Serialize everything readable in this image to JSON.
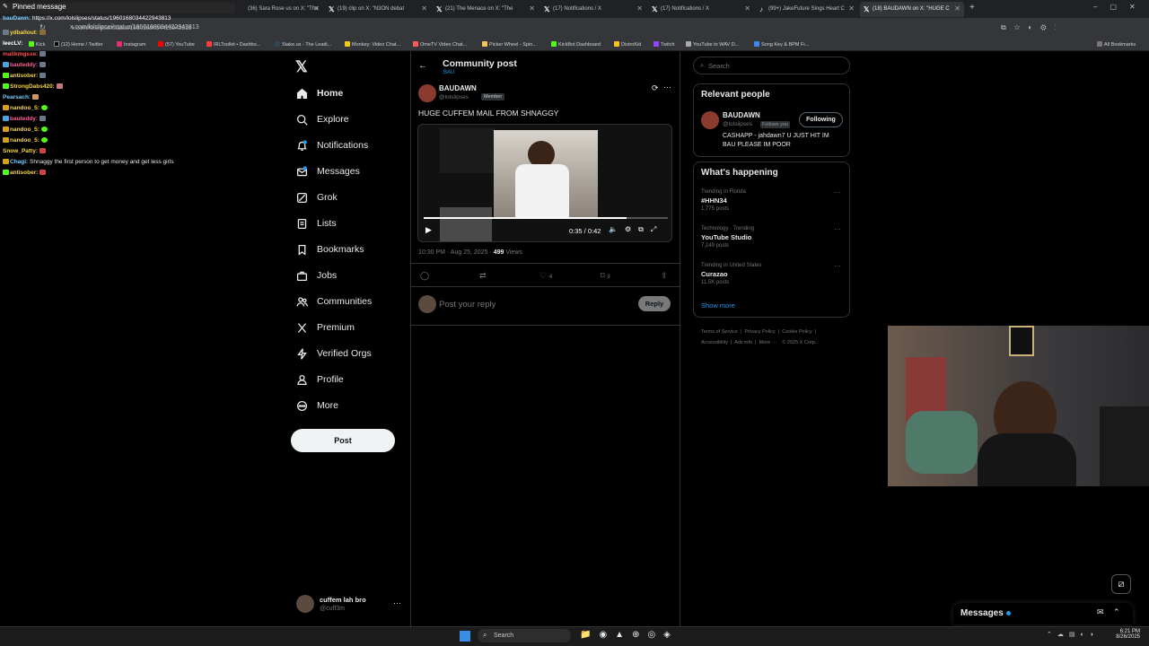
{
  "browser": {
    "tabs": [
      {
        "label": "(36) Sara Rose us",
        "suffix": "on X: \"The"
      },
      {
        "label": "(19) clip",
        "suffix": "on X: \"N3ON debat"
      },
      {
        "label": "(21) The Menace",
        "suffix": "on X: \"The"
      },
      {
        "label": "(17) Notifications / X",
        "suffix": ""
      },
      {
        "label": "(17) Notifications / X",
        "suffix": ""
      },
      {
        "label": "(99+) JakeFuture Sings Heart C",
        "suffix": ""
      },
      {
        "label": "(18) BAUDAWN on X: \"HUGE C",
        "suffix": ""
      }
    ],
    "url": "x.com/lolslipsei/status/1960168034422943813",
    "bookmarks": [
      "Kick",
      "(12) Home / Twitter",
      "Instagram",
      "(57) YouTube",
      "IRLToolkit • Dashbo...",
      "Stake.us - The Leadi...",
      "Monkey: Video Chat...",
      "OmeTV Video Chat...",
      "Picker Wheel - Spin...",
      "KickBot Dashboard",
      "DistroKid",
      "Twitch",
      "YouTube to WAV D...",
      "Song Key & BPM Fi..."
    ],
    "all_bookmarks": "All Bookmarks"
  },
  "chat": {
    "pinned_title": "Pinned message",
    "pinned_user": "bauDawn:",
    "pinned_url": "https://x.com/lolslipses/status/1960168034422943813",
    "pinned_url2": "x.com/lolslipsei/status/1960168034422943813",
    "lines": [
      {
        "user": "ydballout:",
        "msg": "",
        "color": "#f5d547"
      },
      {
        "user": "leecLV:",
        "msg": "",
        "color": "#ffffff"
      },
      {
        "user": "malikmgsse:",
        "msg": "",
        "color": "#ff4f4f"
      },
      {
        "user": "bauteddy:",
        "msg": "",
        "color": "#ff5f9e"
      },
      {
        "user": "antisober:",
        "msg": "",
        "color": "#f5d547"
      },
      {
        "user": "StrongDabs420:",
        "msg": "",
        "color": "#f5d547"
      },
      {
        "user": "Pearsach:",
        "msg": "",
        "color": "#7ad0ff"
      },
      {
        "user": "nandoo_5:",
        "msg": "",
        "color": "#f5d547"
      },
      {
        "user": "bauteddy:",
        "msg": "",
        "color": "#ff5f9e"
      },
      {
        "user": "nandoo_5:",
        "msg": "",
        "color": "#f5d547"
      },
      {
        "user": "nandoo_5:",
        "msg": "",
        "color": "#f5d547"
      },
      {
        "user": "Snow_Patty:",
        "msg": "",
        "color": "#f5d547"
      },
      {
        "user": "Chagi:",
        "msg": "Shnaggy the first person to get money and get less girls",
        "color": "#7ad0ff"
      },
      {
        "user": "antisober:",
        "msg": "",
        "color": "#f5d547"
      }
    ]
  },
  "nav": {
    "items": [
      "Home",
      "Explore",
      "Notifications",
      "Messages",
      "Grok",
      "Lists",
      "Bookmarks",
      "Jobs",
      "Communities",
      "Premium",
      "Verified Orgs",
      "Profile",
      "More"
    ],
    "post_label": "Post",
    "account_name": "cuffem lah bro",
    "account_handle": "@cuff3m"
  },
  "post": {
    "header_title": "Community post",
    "community": "BAU",
    "author": "BAUDAWN",
    "handle": "@lolslipses",
    "role_badge": "Member",
    "text": "HUGE CUFFEM MAIL FROM SHNAGGY",
    "video_time": "0:35 / 0:42",
    "video_progress": 0.83,
    "timestamp": "10:30 PM · Aug 25, 2025 ·",
    "views_count": "499",
    "views_label": "Views",
    "likes": "4",
    "bookmarks": "3",
    "reply_placeholder": "Post your reply",
    "reply_button": "Reply"
  },
  "sidebar": {
    "search_placeholder": "Search",
    "relevant_title": "Relevant people",
    "person_name": "BAUDAWN",
    "person_handle": "@lolslipses",
    "follows_you": "Follows you",
    "following_label": "Following",
    "person_bio": "CASHAPP - jahdawn7 U JUST HIT IM BAU PLEASE IM POOR",
    "happening_title": "What's happening",
    "trends": [
      {
        "context": "Trending in Florida",
        "name": "#HHN34",
        "count": "1,775 posts"
      },
      {
        "context": "Technology · Trending",
        "name": "YouTube Studio",
        "count": "7,149 posts"
      },
      {
        "context": "Trending in United States",
        "name": "Curazao",
        "count": "11.5K posts"
      }
    ],
    "show_more": "Show more",
    "footer_links": [
      "Terms of Service",
      "Privacy Policy",
      "Cookie Policy",
      "Accessibility",
      "Ads info",
      "More ···",
      "© 2025 X Corp."
    ]
  },
  "dock": {
    "messages_label": "Messages"
  },
  "taskbar": {
    "search_label": "Search",
    "time": "6:21 PM",
    "date": "8/26/2025"
  },
  "colors": {
    "accent": "#1d9bf0",
    "text": "#e7e9ea",
    "muted": "#71767b",
    "border": "#2f3336"
  }
}
